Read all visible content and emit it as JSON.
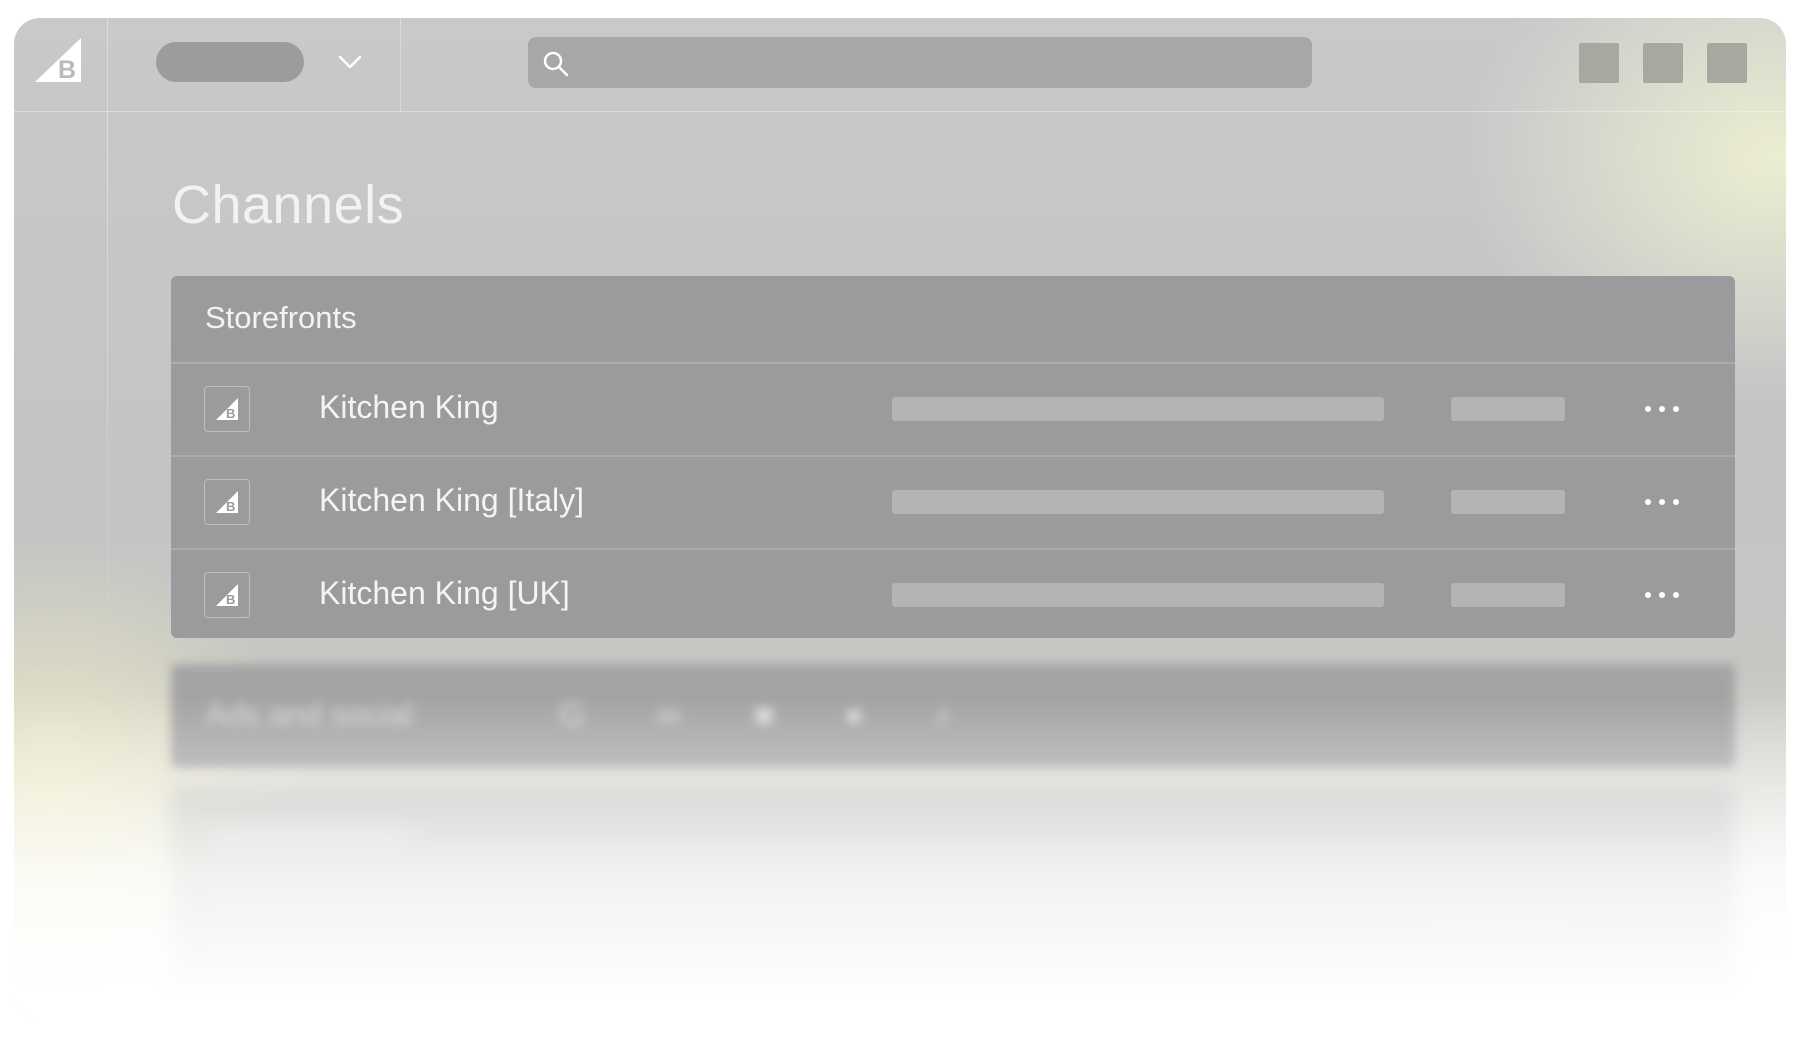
{
  "app": {
    "logo_icon": "bigcommerce-logo-icon"
  },
  "header": {
    "store_switcher_icon": "chevron-down-icon",
    "search": {
      "placeholder": "",
      "icon": "search-icon"
    },
    "actions": [
      "square-action-1",
      "square-action-2",
      "square-action-3"
    ]
  },
  "page": {
    "title": "Channels"
  },
  "storefronts": {
    "header_label": "Storefronts",
    "rows": [
      {
        "name": "Kitchen King",
        "icon": "bigcommerce-logo-icon",
        "menu_icon": "more-horizontal-icon"
      },
      {
        "name": "Kitchen King [Italy]",
        "icon": "bigcommerce-logo-icon",
        "menu_icon": "more-horizontal-icon"
      },
      {
        "name": "Kitchen King [UK]",
        "icon": "bigcommerce-logo-icon",
        "menu_icon": "more-horizontal-icon"
      }
    ]
  },
  "ads_social": {
    "label": "Ads and social",
    "logos": [
      "google-icon",
      "meta-icon",
      "microsoft-icon",
      "pinterest-icon",
      "tiktok-icon"
    ]
  },
  "colors": {
    "card_bg": "#9a9b9c",
    "text_light": "#f4f4f4",
    "placeholder_bar": "#b3b4b5"
  }
}
